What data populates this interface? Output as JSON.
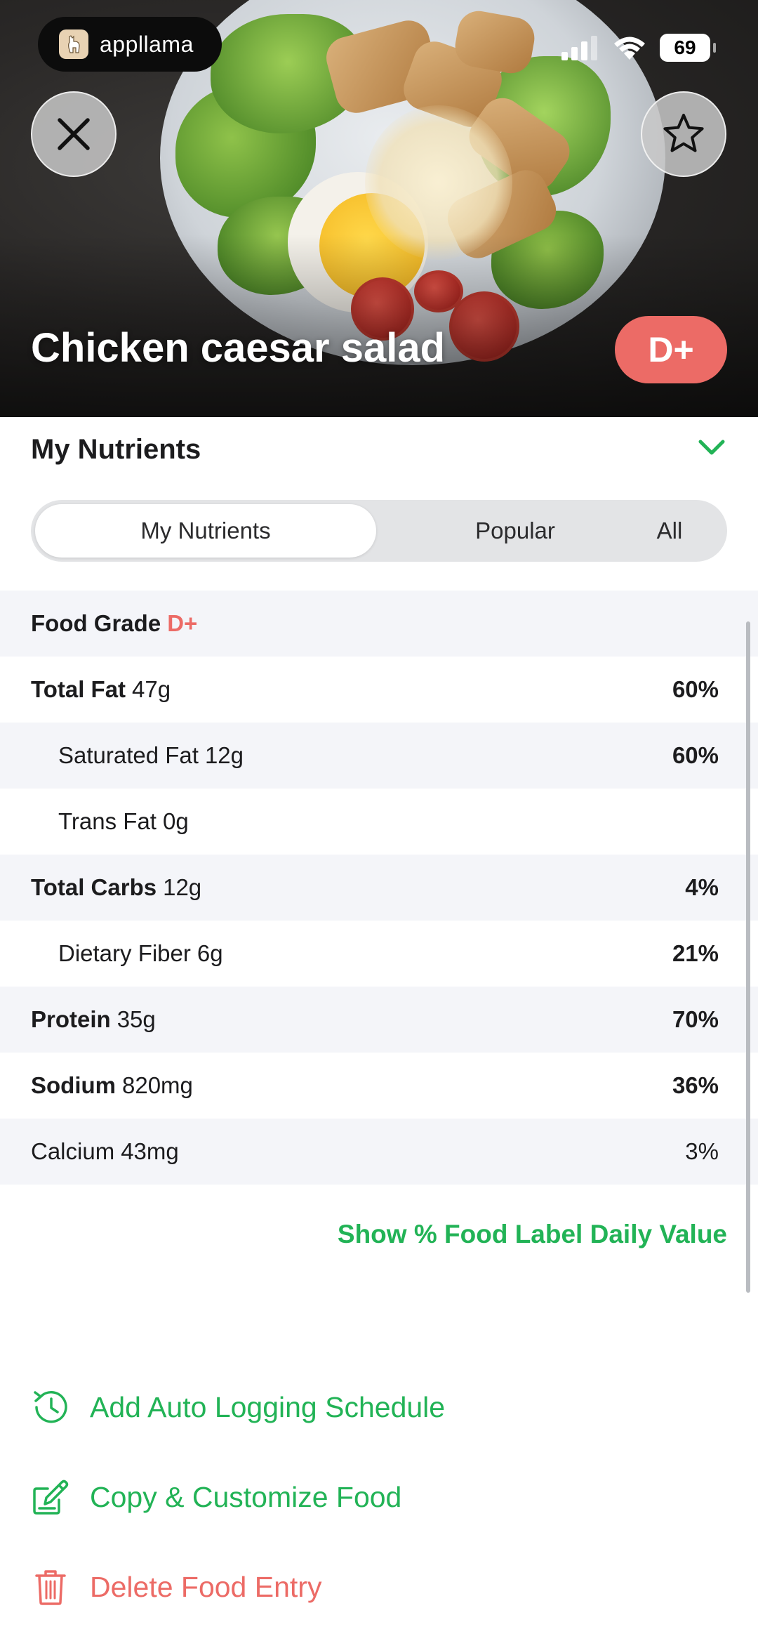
{
  "status_bar": {
    "app_name": "appllama",
    "battery": "69",
    "icons": [
      "signal-icon",
      "wifi-icon",
      "battery-icon"
    ]
  },
  "header": {
    "food_name": "Chicken caesar salad",
    "grade": "D+",
    "close_icon": "close-icon",
    "favorite_icon": "star-icon"
  },
  "nutrients_section": {
    "title": "My Nutrients",
    "tabs": [
      {
        "label": "My Nutrients",
        "active": true
      },
      {
        "label": "Popular",
        "active": false
      },
      {
        "label": "All",
        "active": false
      }
    ],
    "food_grade_label": "Food Grade",
    "food_grade_value": "D+",
    "rows": [
      {
        "name": "Total Fat",
        "amount": "47g",
        "pct": "60%"
      },
      {
        "name": "Saturated Fat",
        "amount": "12g",
        "pct": "60%"
      },
      {
        "name": "Trans Fat",
        "amount": "0g",
        "pct": ""
      },
      {
        "name": "Total Carbs",
        "amount": "12g",
        "pct": "4%"
      },
      {
        "name": "Dietary Fiber",
        "amount": "6g",
        "pct": "21%"
      },
      {
        "name": "Protein",
        "amount": "35g",
        "pct": "70%"
      },
      {
        "name": "Sodium",
        "amount": "820mg",
        "pct": "36%"
      },
      {
        "name": "Calcium",
        "amount": "43mg",
        "pct": "3%"
      }
    ],
    "daily_value_link": "Show % Food Label Daily Value"
  },
  "actions": [
    {
      "label": "Add Auto Logging Schedule",
      "icon": "history-clock-icon"
    },
    {
      "label": "Copy & Customize Food",
      "icon": "edit-square-icon"
    },
    {
      "label": "Delete Food Entry",
      "icon": "trash-icon"
    }
  ],
  "colors": {
    "accent_green": "#22b356",
    "grade_red": "#ec6b66",
    "row_alt": "#f4f5f9"
  }
}
